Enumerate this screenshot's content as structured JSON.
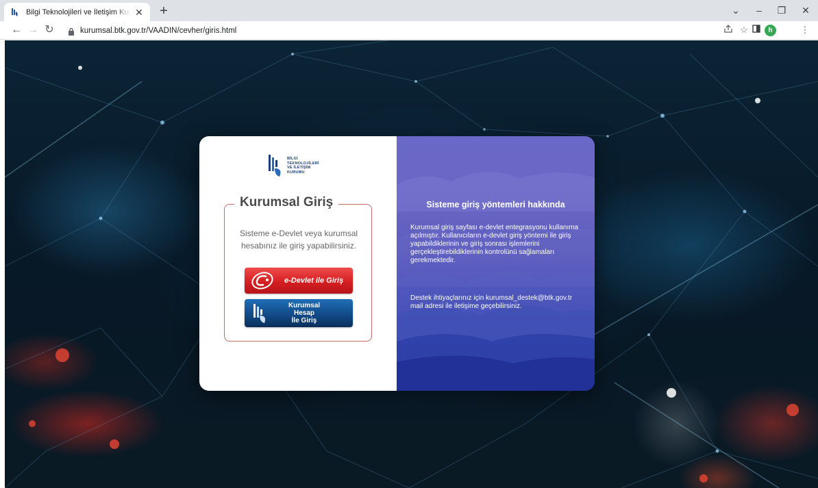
{
  "browser": {
    "tab_title": "Bilgi Teknolojileri ve İletişim Kurumu",
    "new_tab": "+",
    "tab_close": "✕",
    "url": "kurumsal.btk.gov.tr/VAADIN/cevher/giris.html",
    "profile_initial": "h",
    "window_controls": [
      "⌄",
      "–",
      "❐",
      "✕"
    ],
    "icons": [
      "back-icon",
      "forward-icon",
      "reload-icon",
      "lock-icon",
      "share-icon",
      "bookmark-star-icon",
      "side-panel-icon",
      "profile-avatar",
      "menu-icon"
    ]
  },
  "logo": {
    "lines": [
      "BİLGİ",
      "TEKNOLOJİLERİ",
      "VE İLETİŞİM",
      "KURUMU"
    ]
  },
  "login": {
    "title": "Kurumsal Giriş",
    "description": "Sisteme e-Devlet veya kurumsal hesabınız ile giriş yapabilirsiniz.",
    "edevlet_button": "e-Devlet ile Giriş",
    "kurumsal_button_line1": "Kurumsal Hesap",
    "kurumsal_button_line2": "İle Giriş"
  },
  "info": {
    "title": "Sisteme giriş yöntemleri hakkında",
    "text": "Kurumsal giriş sayfası e-devlet entegrasyonu kullanıma açılmıştır. Kullanıcıların e-devlet giriş yöntemi ile giriş yapabildiklerinin ve giriş sonrası işlemlerini gerçekleştirebildiklerinin kontrolünü sağlamaları gerekmektedir.",
    "contact": "Destek ihtiyaçlarınız için kurumsal_destek@btk.gov.tr mail adresi ile iletişime geçebilirsiniz."
  },
  "colors": {
    "edevlet_red": "#d61f22",
    "kurumsal_blue": "#124a88",
    "login_border": "#c76a6a",
    "panel_purple": "#6a68c8",
    "panel_blue": "#2a3aa6"
  }
}
